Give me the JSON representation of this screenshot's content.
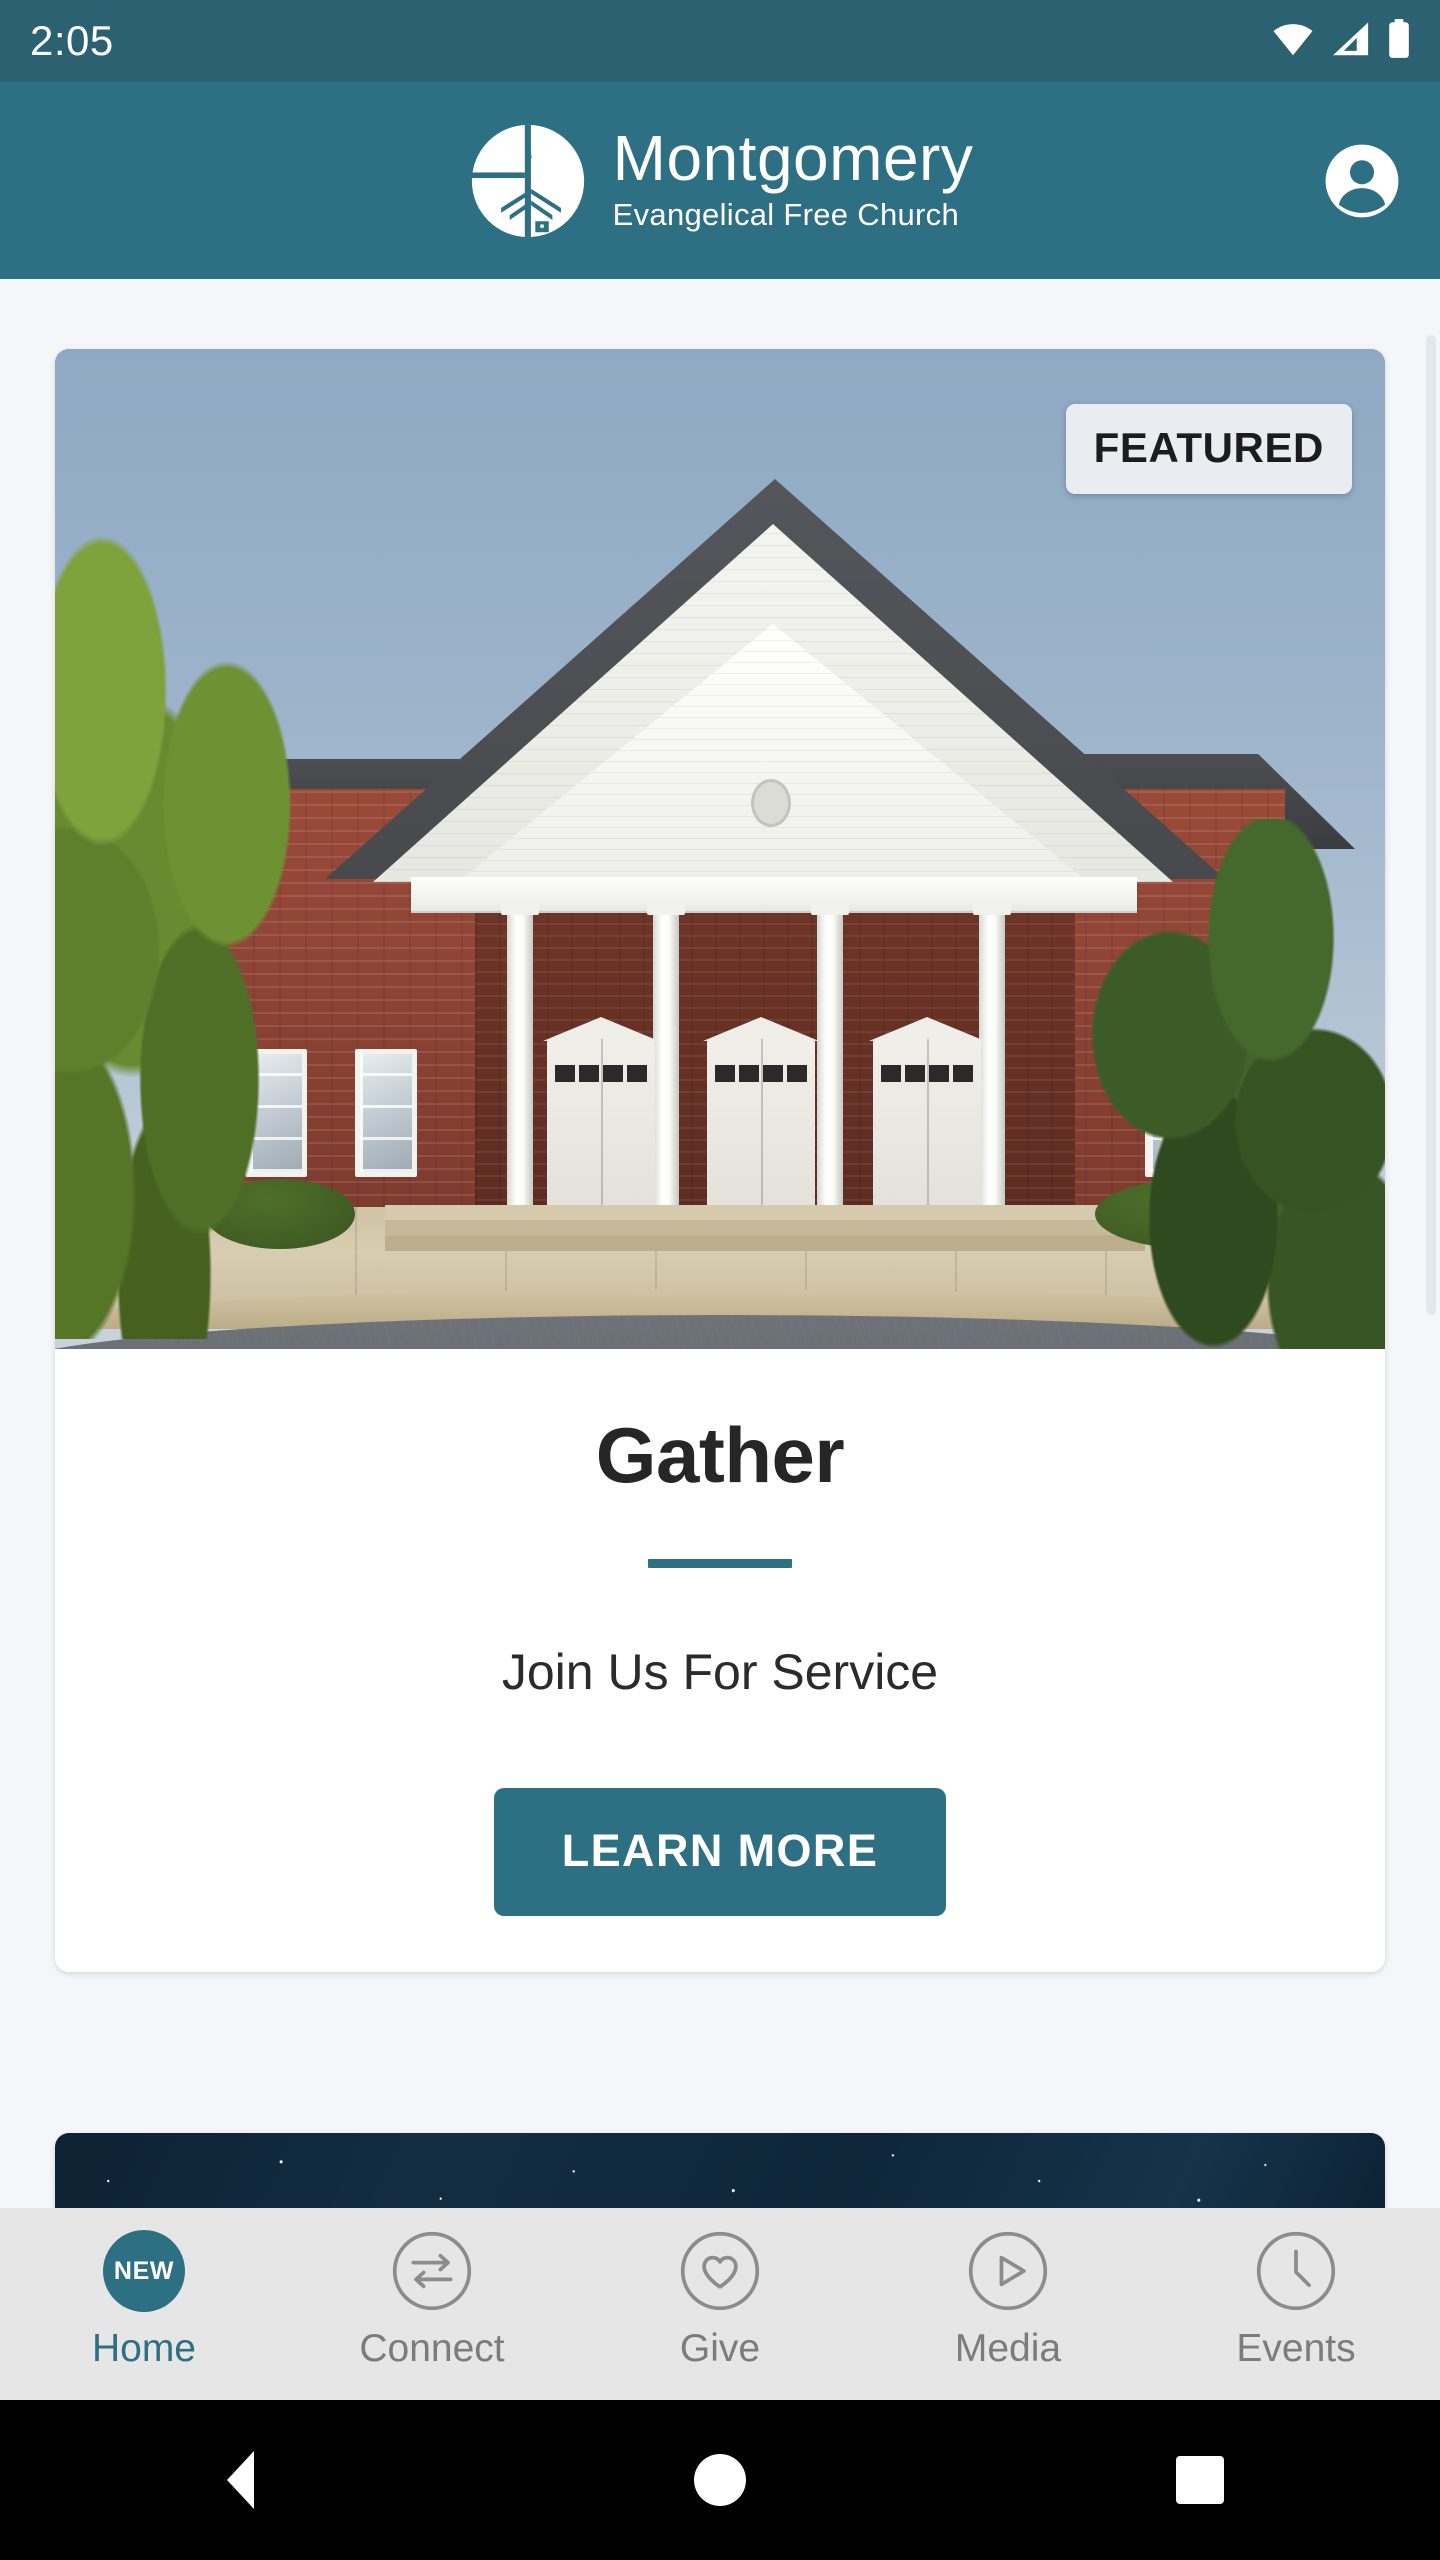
{
  "status_bar": {
    "time": "2:05",
    "icons": [
      "wifi-icon",
      "cellular-signal-icon",
      "battery-icon"
    ]
  },
  "header": {
    "brand_name": "Montgomery",
    "brand_subtitle": "Evangelical Free Church",
    "logo_icon": "church-circle-logo",
    "account_icon": "account-avatar-icon",
    "background_color": "#2E7083"
  },
  "featured_card": {
    "badge": "FEATURED",
    "title": "Gather",
    "subtitle": "Join Us For Service",
    "button_label": "LEARN MORE",
    "image_alt": "Brick church building with white columned portico",
    "accent_color": "#2E7083"
  },
  "next_card": {
    "image_alt": "Starry night sky"
  },
  "tabbar": {
    "items": [
      {
        "label": "Home",
        "icon": "new-badge-icon",
        "badge": "NEW",
        "active": true
      },
      {
        "label": "Connect",
        "icon": "two-way-arrows-icon",
        "active": false
      },
      {
        "label": "Give",
        "icon": "heart-icon",
        "active": false
      },
      {
        "label": "Media",
        "icon": "play-circle-icon",
        "active": false
      },
      {
        "label": "Events",
        "icon": "clock-icon",
        "active": false
      }
    ],
    "active_color": "#2E7083",
    "inactive_color": "#7C7C7C"
  },
  "android_nav": {
    "back": "back-triangle-icon",
    "home": "home-circle-icon",
    "recents": "recents-square-icon"
  }
}
